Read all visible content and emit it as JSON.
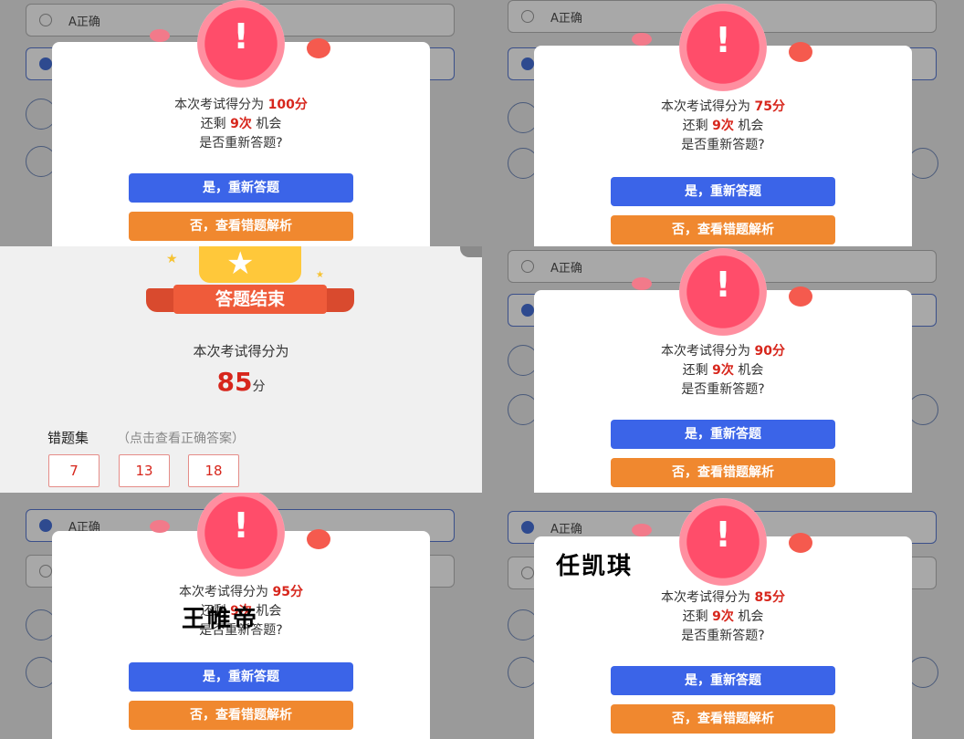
{
  "colors": {
    "accent_red": "#d7261c",
    "blue_button": "#3b64e8",
    "orange_button": "#f0882f"
  },
  "panels": [
    {
      "option_label": "A正确",
      "score_text": "本次考试得分为",
      "score": "100分",
      "remaining_prefix": "还剩",
      "remaining": "9次",
      "remaining_suffix": "机会",
      "question": "是否重新答题?",
      "btn_retry": "是，重新答题",
      "btn_review": "否，查看错题解析"
    },
    {
      "option_label": "A正确",
      "score_text": "本次考试得分为",
      "score": "75分",
      "remaining_prefix": "还剩",
      "remaining": "9次",
      "remaining_suffix": "机会",
      "question": "是否重新答题?",
      "btn_retry": "是，重新答题",
      "btn_review": "否，查看错题解析"
    },
    {
      "option_label": "A正确",
      "score_text": "本次考试得分为",
      "score": "90分",
      "remaining_prefix": "还剩",
      "remaining": "9次",
      "remaining_suffix": "机会",
      "question": "是否重新答题?",
      "btn_retry": "是，重新答题",
      "btn_review": "否，查看错题解析"
    },
    {
      "option_label": "A正确",
      "score_text": "本次考试得分为",
      "score": "95分",
      "remaining_prefix": "还剩",
      "remaining": "9次",
      "remaining_suffix": "机会",
      "question": "是否重新答题?",
      "btn_retry": "是，重新答题",
      "btn_review": "否，查看错题解析",
      "overlay_name": "王帷帝"
    },
    {
      "option_label": "A正确",
      "score_text": "本次考试得分为",
      "score": "85分",
      "remaining_prefix": "还剩",
      "remaining": "9次",
      "remaining_suffix": "机会",
      "question": "是否重新答题?",
      "btn_retry": "是，重新答题",
      "btn_review": "否，查看错题解析",
      "overlay_name": "任凯琪"
    }
  ],
  "result": {
    "banner": "答题结束",
    "score_text": "本次考试得分为",
    "score_value": "85",
    "score_unit": "分",
    "wrong_title": "错题集",
    "wrong_hint": "（点击查看正确答案）",
    "wrong_items": [
      "7",
      "13",
      "18"
    ]
  }
}
